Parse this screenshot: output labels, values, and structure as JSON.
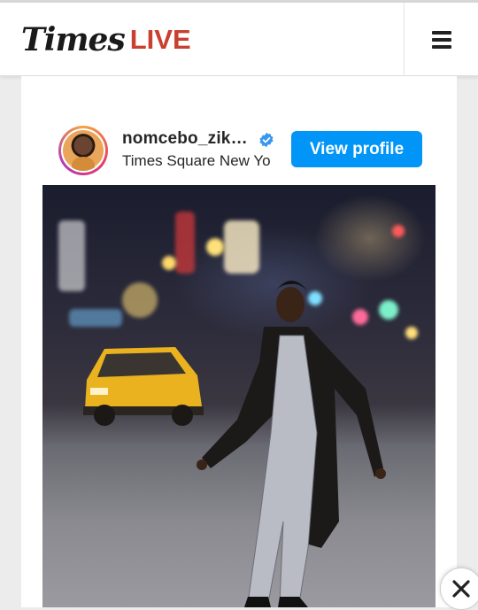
{
  "header": {
    "logo_part1": "Times",
    "logo_part2": "LIVE",
    "menu_icon": "hamburger-menu-icon"
  },
  "embed": {
    "username": "nomcebo_zik…",
    "verified_icon": "verified-badge-icon",
    "location": "Times Square New Yo",
    "view_profile_label": "View profile",
    "photo_alt": "Woman in snakeskin jumpsuit and leather coat posing in Times Square at night with yellow taxi"
  },
  "overlay": {
    "close_icon": "close-icon"
  },
  "colors": {
    "logo_live": "#c8402f",
    "button": "#0095f6",
    "page_bg": "#ececec"
  }
}
